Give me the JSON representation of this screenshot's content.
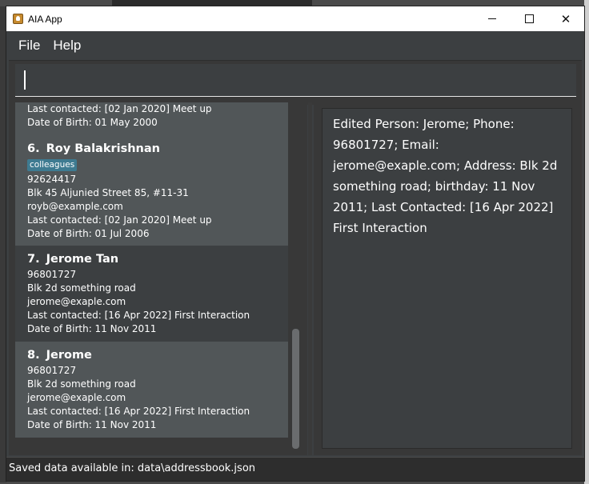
{
  "window": {
    "title": "AIA App",
    "controls": {
      "minimize": "minimize",
      "maximize": "maximize",
      "close": "✕"
    }
  },
  "menu": {
    "file": "File",
    "help": "Help"
  },
  "command": {
    "value": ""
  },
  "person_list": {
    "partial_card": {
      "last_contacted": "Last contacted: [02 Jan 2020] Meet up",
      "dob": "Date of Birth: 01 May 2000"
    },
    "cards": [
      {
        "index": "6.",
        "name": "Roy Balakrishnan",
        "tags": [
          "colleagues"
        ],
        "phone": "92624417",
        "address": "Blk 45 Aljunied Street 85, #11-31",
        "email": "royb@example.com",
        "last_contacted": "Last contacted: [02 Jan 2020] Meet up",
        "dob": "Date of Birth: 01 Jul 2006"
      },
      {
        "index": "7.",
        "name": "Jerome Tan",
        "tags": [],
        "phone": "96801727",
        "address": "Blk 2d something road",
        "email": "jerome@exaple.com",
        "last_contacted": "Last contacted: [16 Apr 2022] First Interaction",
        "dob": "Date of Birth: 11 Nov 2011"
      },
      {
        "index": "8.",
        "name": "Jerome",
        "tags": [],
        "phone": "96801727",
        "address": "Blk 2d something road",
        "email": "jerome@exaple.com",
        "last_contacted": "Last contacted: [16 Apr 2022] First Interaction",
        "dob": "Date of Birth: 11 Nov 2011"
      }
    ]
  },
  "result": {
    "text": "Edited Person: Jerome; Phone: 96801727; Email: jerome@exaple.com; Address: Blk 2d something road; birthday: 11 Nov 2011; Last Contacted: [16 Apr 2022] First Interaction"
  },
  "status": {
    "text": "Saved data available in: data\\addressbook.json"
  },
  "colors": {
    "background": "#3c3f41",
    "card_selected": "#515658",
    "tag": "#3e7b91",
    "statusbar": "#2d2d2d"
  }
}
